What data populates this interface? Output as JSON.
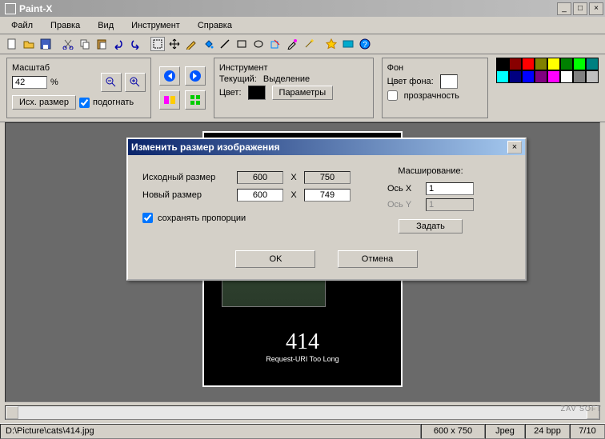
{
  "app": {
    "title": "Paint-X"
  },
  "menu": [
    "Файл",
    "Правка",
    "Вид",
    "Инструмент",
    "Справка"
  ],
  "zoom": {
    "legend": "Масштаб",
    "value": "42",
    "percent": "%",
    "reset_btn": "Исх. размер",
    "fit_label": "подогнать"
  },
  "tool": {
    "legend": "Инструмент",
    "current_lbl": "Текущий:",
    "current_val": "Выделение",
    "color_lbl": "Цвет:",
    "params_btn": "Параметры"
  },
  "bg": {
    "legend": "Фон",
    "color_lbl": "Цвет фона:",
    "transp_lbl": "прозрачность"
  },
  "palette": [
    "#000",
    "#800",
    "#f00",
    "#808000",
    "#ff0",
    "#008000",
    "#0f0",
    "#008080",
    "#0ff",
    "#000080",
    "#00f",
    "#800080",
    "#f0f",
    "#fff",
    "#808080",
    "#c0c0c0"
  ],
  "canvas": {
    "num": "414",
    "caption": "Request-URI Too Long"
  },
  "dialog": {
    "title": "Изменить размер изображения",
    "orig_lbl": "Исходный размер",
    "orig_w": "600",
    "orig_h": "750",
    "new_lbl": "Новый размер",
    "new_w": "600",
    "new_h": "749",
    "keep_ratio": "сохранять пропорции",
    "scale_lbl": "Масширование:",
    "axis_x": "Ось X",
    "axis_y": "Ось Y",
    "sx": "1",
    "sy": "1",
    "set_btn": "Задать",
    "ok": "OK",
    "cancel": "Отмена"
  },
  "status": {
    "path": "D:\\Picture\\cats\\414.jpg",
    "dims": "600 x 750",
    "fmt": "Jpeg",
    "bpp": "24 bpp",
    "idx": "7/10"
  },
  "watermark": "ZAV SOFT"
}
